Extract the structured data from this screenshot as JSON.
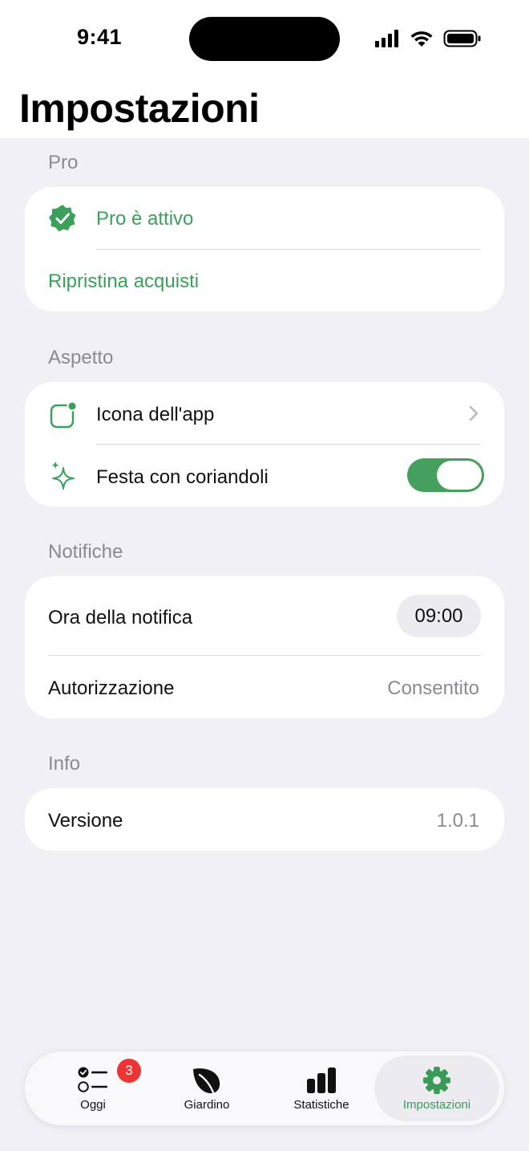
{
  "status_bar": {
    "time": "9:41"
  },
  "header": {
    "title": "Impostazioni"
  },
  "sections": {
    "pro": {
      "header": "Pro",
      "status_label": "Pro è attivo",
      "restore_label": "Ripristina acquisti"
    },
    "appearance": {
      "header": "Aspetto",
      "app_icon_label": "Icona dell'app",
      "confetti_label": "Festa con coriandoli",
      "confetti_enabled": true
    },
    "notifications": {
      "header": "Notifiche",
      "time_label": "Ora della notifica",
      "time_value": "09:00",
      "authorization_label": "Autorizzazione",
      "authorization_value": "Consentito"
    },
    "info": {
      "header": "Info",
      "version_label": "Versione",
      "version_value": "1.0.1"
    }
  },
  "tab_bar": {
    "tabs": [
      {
        "label": "Oggi",
        "icon": "checklist-icon",
        "badge": "3"
      },
      {
        "label": "Giardino",
        "icon": "leaf-icon"
      },
      {
        "label": "Statistiche",
        "icon": "bar-chart-icon"
      },
      {
        "label": "Impostazioni",
        "icon": "gear-icon",
        "active": true
      }
    ]
  },
  "colors": {
    "accent": "#3aa05a",
    "background": "#f0f0f5",
    "badge": "#ee3535"
  }
}
